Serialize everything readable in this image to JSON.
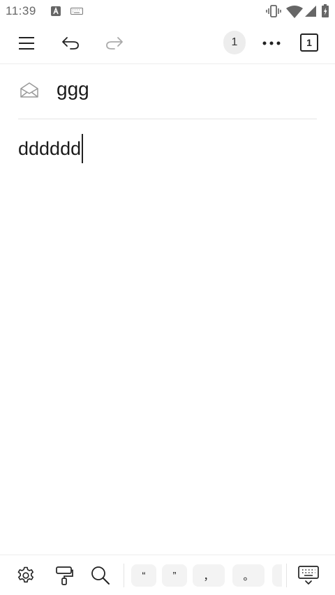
{
  "status_bar": {
    "time": "11:39"
  },
  "toolbar": {
    "note_count": "1",
    "page_number": "1"
  },
  "editor": {
    "subject": "ggg",
    "body": "dddddd"
  },
  "bottom_bar": {
    "punctuation": [
      "“",
      "”",
      "，",
      "。"
    ]
  },
  "icons": [
    "menu-icon",
    "undo-icon",
    "redo-icon",
    "more-icon",
    "envelope-icon",
    "settings-icon",
    "format-paint-icon",
    "search-icon",
    "keyboard-hide-icon"
  ]
}
